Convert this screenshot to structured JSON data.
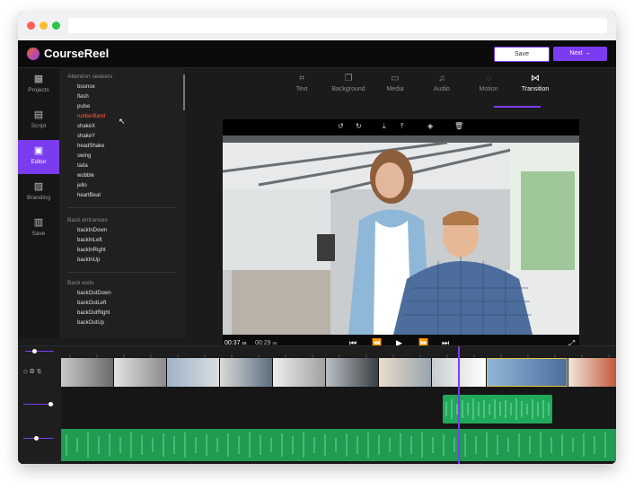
{
  "app": {
    "name": "CourseReel"
  },
  "header": {
    "save_label": "Save",
    "next_label": "Next"
  },
  "nav": [
    {
      "label": "Projects",
      "icon": "grid-icon"
    },
    {
      "label": "Script",
      "icon": "document-icon"
    },
    {
      "label": "Editor",
      "icon": "editor-icon"
    },
    {
      "label": "Branding",
      "icon": "image-icon"
    },
    {
      "label": "Save",
      "icon": "save-icon"
    }
  ],
  "animations": {
    "sections": [
      {
        "title": "Attention seekers",
        "items": [
          "bounce",
          "flash",
          "pulse",
          "rubberBand",
          "shakeX",
          "shakeY",
          "headShake",
          "swing",
          "tada",
          "wobble",
          "jello",
          "heartBeat"
        ]
      },
      {
        "title": "Back entrances",
        "items": [
          "backInDown",
          "backInLeft",
          "backInRight",
          "backInUp"
        ]
      },
      {
        "title": "Back exits",
        "items": [
          "backOutDown",
          "backOutLeft",
          "backOutRight",
          "backOutUp"
        ]
      }
    ],
    "selected": "rubberBand"
  },
  "tabs": [
    {
      "label": "Text"
    },
    {
      "label": "Background"
    },
    {
      "label": "Media"
    },
    {
      "label": "Audio"
    },
    {
      "label": "Motion"
    },
    {
      "label": "Transition"
    }
  ],
  "active_tab": "Transition",
  "player": {
    "current_time": "00:37",
    "current_suffix": "ss",
    "total_time": "00:29",
    "total_suffix": "ss"
  },
  "colors": {
    "accent": "#7b3cf0",
    "audio_green": "#22a85a",
    "selected_item": "#ff5a3a"
  }
}
